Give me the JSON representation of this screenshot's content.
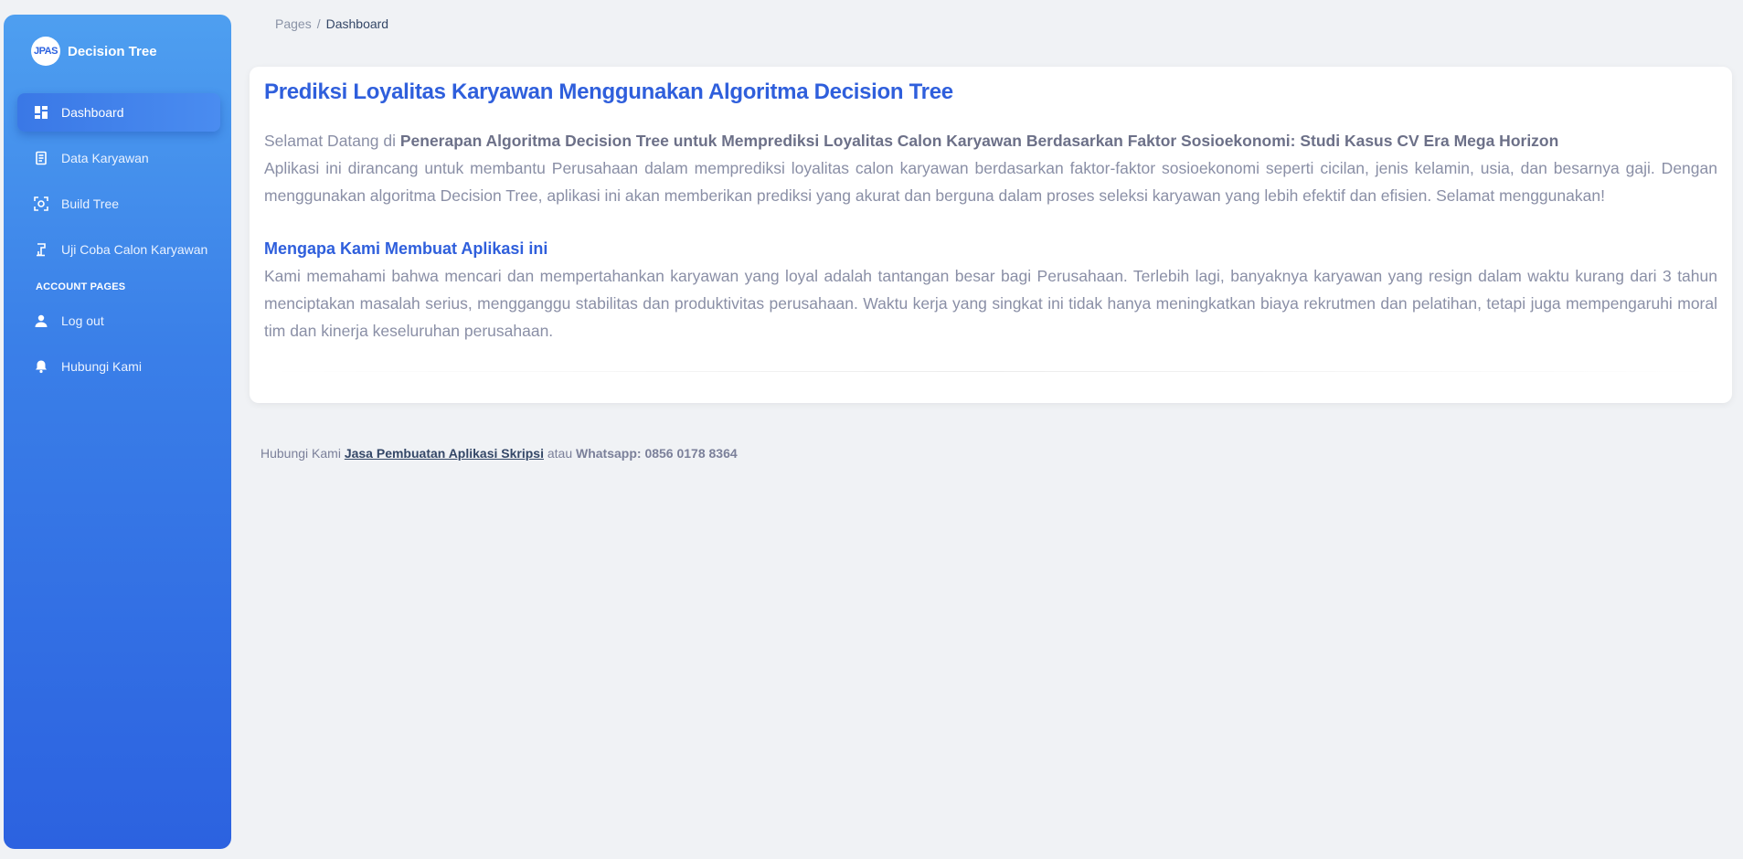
{
  "sidebar": {
    "brand_logo": "JPAS",
    "brand_name": "Decision Tree",
    "items": [
      {
        "label": "Dashboard",
        "icon": "dashboard-icon"
      },
      {
        "label": "Data Karyawan",
        "icon": "document-icon"
      },
      {
        "label": "Build Tree",
        "icon": "scan-icon"
      },
      {
        "label": "Uji Coba Calon Karyawan",
        "icon": "test-icon"
      }
    ],
    "section_label": "ACCOUNT PAGES",
    "account_items": [
      {
        "label": "Log out",
        "icon": "person-icon"
      },
      {
        "label": "Hubungi Kami",
        "icon": "bell-icon"
      }
    ]
  },
  "breadcrumb": {
    "parent": "Pages",
    "separator": "/",
    "current": "Dashboard"
  },
  "main": {
    "title": "Prediksi Loyalitas Karyawan Menggunakan Algoritma Decision Tree",
    "welcome_prefix": "Selamat Datang di ",
    "welcome_bold": "Penerapan Algoritma Decision Tree untuk Memprediksi Loyalitas Calon Karyawan Berdasarkan Faktor Sosioekonomi: Studi Kasus CV Era Mega Horizon",
    "intro": "Aplikasi ini dirancang untuk membantu Perusahaan dalam memprediksi loyalitas calon karyawan berdasarkan faktor-faktor sosioekonomi seperti cicilan, jenis kelamin, usia, dan besarnya gaji. Dengan menggunakan algoritma Decision Tree, aplikasi ini akan memberikan prediksi yang akurat dan berguna dalam proses seleksi karyawan yang lebih efektif dan efisien. Selamat menggunakan!",
    "subtitle": "Mengapa Kami Membuat Aplikasi ini",
    "reason": "Kami memahami bahwa mencari dan mempertahankan karyawan yang loyal adalah tantangan besar bagi Perusahaan. Terlebih lagi, banyaknya karyawan yang resign dalam waktu kurang dari 3 tahun menciptakan masalah serius, mengganggu stabilitas dan produktivitas perusahaan. Waktu kerja yang singkat ini tidak hanya meningkatkan biaya rekrutmen dan pelatihan, tetapi juga mempengaruhi moral tim dan kinerja keseluruhan perusahaan."
  },
  "footer": {
    "prefix": "Hubungi Kami ",
    "link": "Jasa Pembuatan Aplikasi Skripsi",
    "middle": " atau ",
    "whatsapp": "Whatsapp: 0856 0178 8364"
  },
  "colors": {
    "accent": "#2f5fdc",
    "sidebar_top": "#4e9ff0",
    "sidebar_bottom": "#2c62e0",
    "background": "#f0f2f5"
  }
}
